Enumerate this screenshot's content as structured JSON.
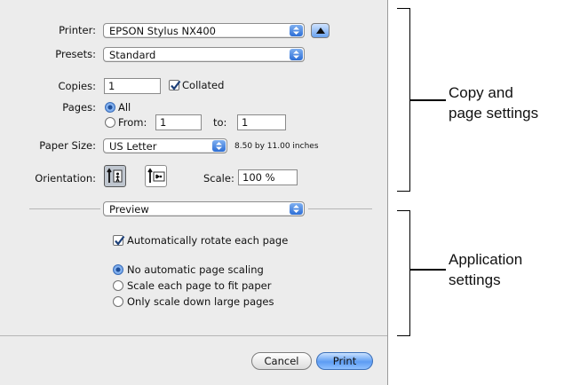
{
  "dialog": {
    "printer": {
      "label": "Printer:",
      "value": "EPSON Stylus NX400"
    },
    "presets": {
      "label": "Presets:",
      "value": "Standard"
    },
    "copies": {
      "label": "Copies:",
      "value": "1",
      "collated_label": "Collated",
      "collated_checked": true
    },
    "pages": {
      "label": "Pages:",
      "all_label": "All",
      "from_label": "From:",
      "from_value": "1",
      "to_label": "to:",
      "to_value": "1",
      "selected": "all"
    },
    "paper_size": {
      "label": "Paper Size:",
      "value": "US Letter",
      "dimensions": "8.50 by 11.00 inches"
    },
    "orientation": {
      "label": "Orientation:",
      "selected": "portrait"
    },
    "scale": {
      "label": "Scale:",
      "value": "100 %"
    },
    "section_popup": {
      "value": "Preview"
    },
    "auto_rotate": {
      "label": "Automatically rotate each page",
      "checked": true
    },
    "scaling_options": [
      {
        "label": "No automatic page scaling",
        "selected": true
      },
      {
        "label": "Scale each page to fit paper",
        "selected": false
      },
      {
        "label": "Only scale down large pages",
        "selected": false
      }
    ],
    "buttons": {
      "cancel": "Cancel",
      "print": "Print"
    }
  },
  "callouts": {
    "copy_page": {
      "line1": "Copy and",
      "line2": "page settings"
    },
    "application": {
      "line1": "Application",
      "line2": "settings"
    }
  }
}
